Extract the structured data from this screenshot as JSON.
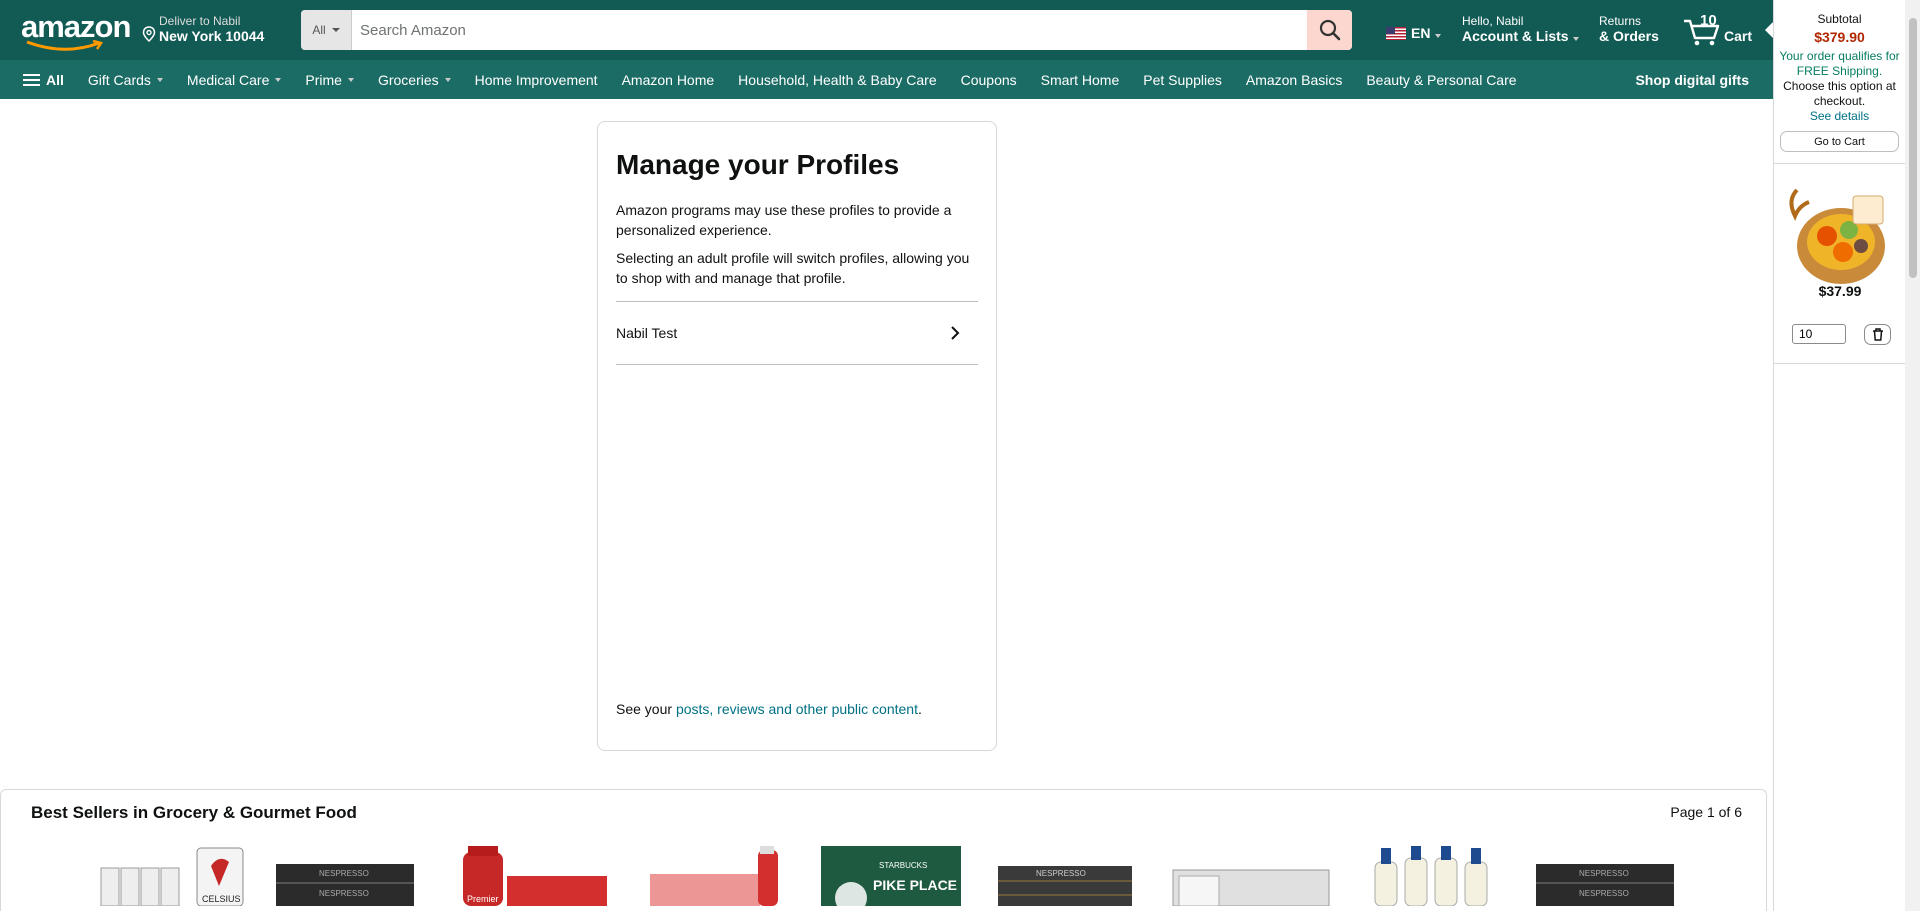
{
  "header": {
    "logo_text": "amazon",
    "deliver_line1": "Deliver to Nabil",
    "deliver_line2": "New York 10044",
    "search_category": "All",
    "search_placeholder": "Search Amazon",
    "language": "EN",
    "account_line1": "Hello, Nabil",
    "account_line2": "Account & Lists",
    "returns_line1": "Returns",
    "returns_line2": "& Orders",
    "cart_count": "10",
    "cart_label": "Cart"
  },
  "subnav": {
    "all_label": "All",
    "items": [
      {
        "label": "Gift Cards",
        "caret": true
      },
      {
        "label": "Medical Care",
        "caret": true
      },
      {
        "label": "Prime",
        "caret": true
      },
      {
        "label": "Groceries",
        "caret": true
      },
      {
        "label": "Home Improvement",
        "caret": false
      },
      {
        "label": "Amazon Home",
        "caret": false
      },
      {
        "label": "Household, Health & Baby Care",
        "caret": false
      },
      {
        "label": "Coupons",
        "caret": false
      },
      {
        "label": "Smart Home",
        "caret": false
      },
      {
        "label": "Pet Supplies",
        "caret": false
      },
      {
        "label": "Amazon Basics",
        "caret": false
      },
      {
        "label": "Beauty & Personal Care",
        "caret": false
      }
    ],
    "right_label": "Shop digital gifts"
  },
  "profiles": {
    "title": "Manage your Profiles",
    "desc1": "Amazon programs may use these profiles to provide a personalized experience.",
    "desc2": "Selecting an adult profile will switch profiles, allowing you to shop with and manage that profile.",
    "profile_name": "Nabil Test",
    "footer_prefix": "See your ",
    "footer_link": "posts, reviews and other public content",
    "footer_suffix": "."
  },
  "best_sellers": {
    "title": "Best Sellers in Grocery & Gourmet Food",
    "page_indicator": "Page 1 of 6"
  },
  "cart_rail": {
    "subtotal_label": "Subtotal",
    "subtotal_value": "$379.90",
    "free_line": "Your order qualifies for FREE Shipping.",
    "choose_line": "Choose this option at checkout.",
    "details_link": "See details",
    "go_to_cart": "Go to Cart",
    "item_price": "$37.99",
    "item_qty": "10"
  },
  "colors": {
    "nav_primary": "#125a54",
    "nav_secondary": "#1c6c66",
    "price_red": "#b12704",
    "link_teal": "#007185",
    "search_button": "#fcd7cf"
  }
}
